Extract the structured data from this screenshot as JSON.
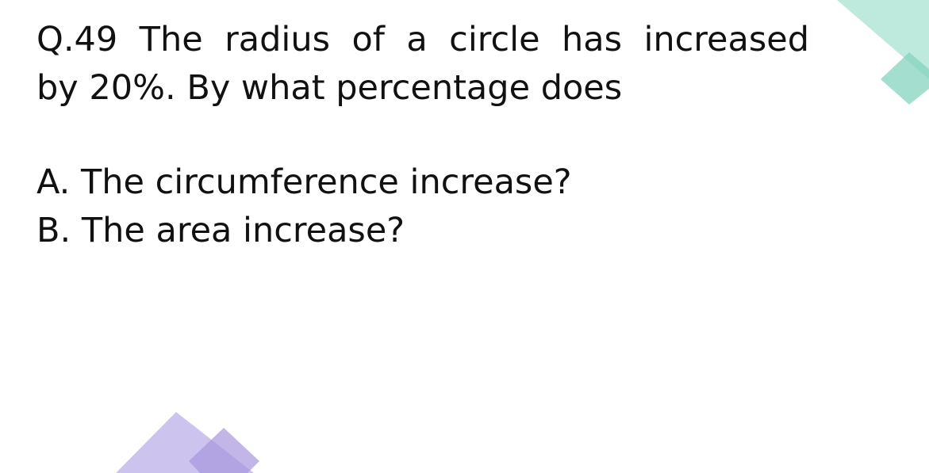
{
  "question": {
    "line1": "Q.49 The radius of a circle has increased",
    "line2": "by 20%. By what percentage does"
  },
  "options": [
    {
      "label": "A. The circumference increase?"
    },
    {
      "label": "B. The area increase?"
    }
  ],
  "decor_colors": {
    "teal": "#a8e3d2",
    "teal_dark": "#86d3bd",
    "lavender": "#c6bcec",
    "lavender_dark": "#a797dd"
  }
}
